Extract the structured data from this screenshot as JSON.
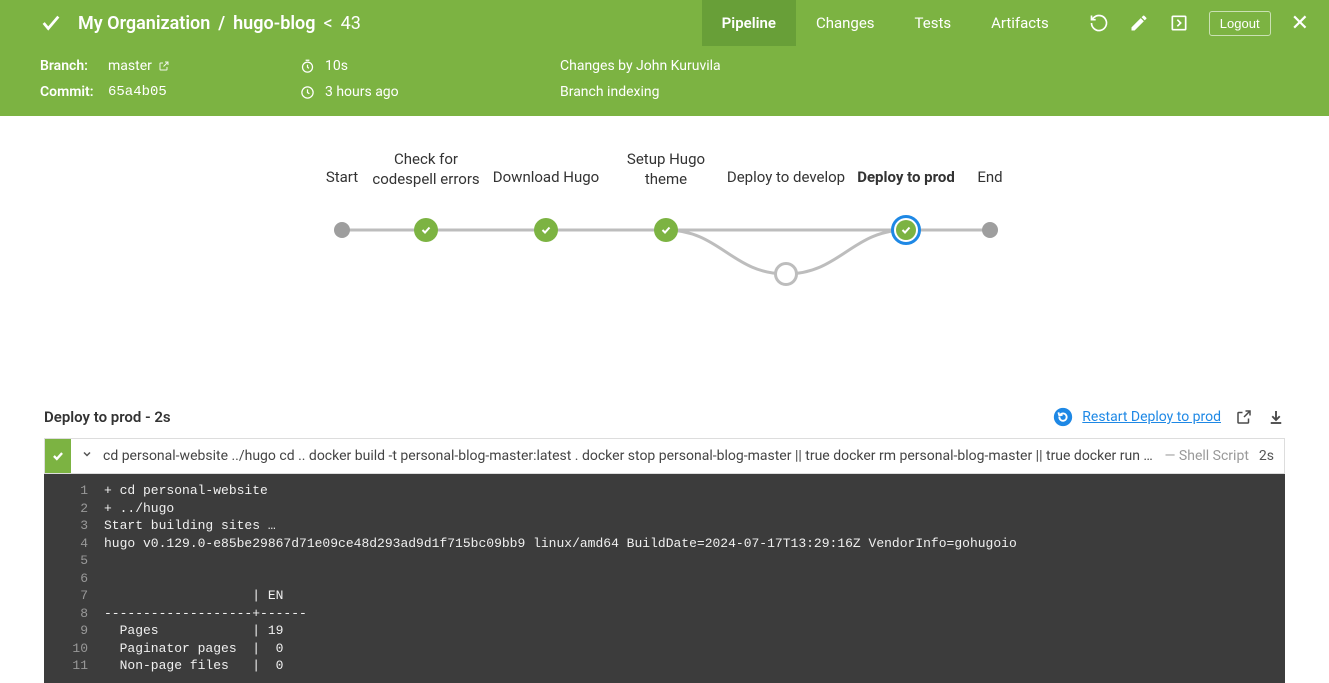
{
  "breadcrumb": {
    "org": "My Organization",
    "project": "hugo-blog",
    "run": "43"
  },
  "nav": {
    "tabs": {
      "pipeline": "Pipeline",
      "changes": "Changes",
      "tests": "Tests",
      "artifacts": "Artifacts"
    },
    "logout": "Logout"
  },
  "meta": {
    "branch_label": "Branch:",
    "branch": "master",
    "commit_label": "Commit:",
    "commit": "65a4b05",
    "duration": "10s",
    "age": "3 hours ago",
    "changes_by": "Changes by John Kuruvila",
    "message": "Branch indexing"
  },
  "pipeline": {
    "stages": {
      "start": "Start",
      "check": "Check for\ncodespell errors",
      "download": "Download Hugo",
      "setup": "Setup Hugo\ntheme",
      "develop": "Deploy to develop",
      "prod": "Deploy to prod",
      "end": "End"
    }
  },
  "section": {
    "title": "Deploy to prod - 2s",
    "restart": "Restart Deploy to prod"
  },
  "step": {
    "cmd": "cd personal-website ../hugo cd .. docker build -t personal-blog-master:latest . docker stop personal-blog-master || true docker rm personal-blog-master || true docker run -d -...",
    "type": "— Shell Script",
    "dur": "2s"
  },
  "console": [
    "+ cd personal-website",
    "+ ../hugo",
    "Start building sites …",
    "hugo v0.129.0-e85be29867d71e09ce48d293ad9d1f715bc09bb9 linux/amd64 BuildDate=2024-07-17T13:29:16Z VendorInfo=gohugoio",
    "",
    "",
    "                   | EN",
    "-------------------+------",
    "  Pages            | 19",
    "  Paginator pages  |  0",
    "  Non-page files   |  0"
  ]
}
